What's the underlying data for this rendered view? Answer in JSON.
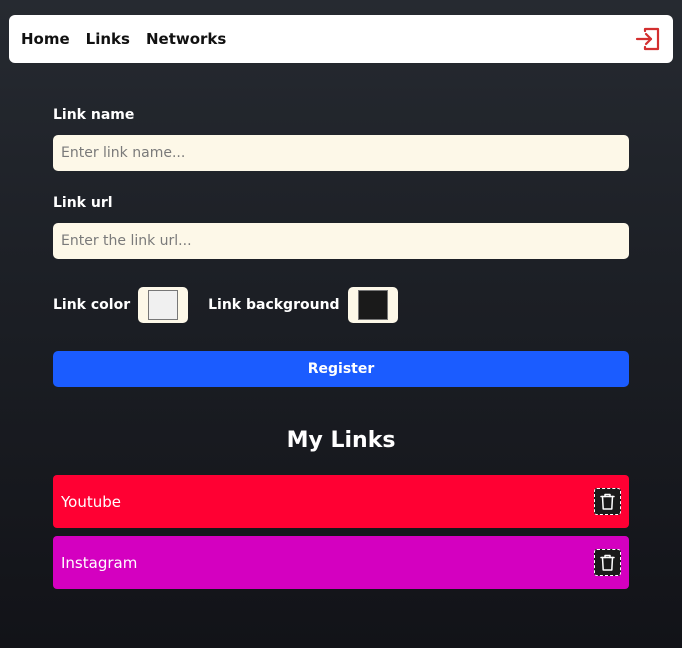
{
  "nav": {
    "items": [
      {
        "label": "Home"
      },
      {
        "label": "Links"
      },
      {
        "label": "Networks"
      }
    ],
    "logout_icon": "logout-icon",
    "logout_color": "#d32f2f"
  },
  "form": {
    "name_label": "Link name",
    "name_placeholder": "Enter link name...",
    "name_value": "",
    "url_label": "Link url",
    "url_placeholder": "Enter the link url...",
    "url_value": "",
    "color_label": "Link color",
    "color_value": "#f0f0f0",
    "background_label": "Link background",
    "background_value": "#1a1a1a",
    "register_label": "Register"
  },
  "links": {
    "title": "My Links",
    "items": [
      {
        "name": "Youtube",
        "color": "#ffffff",
        "background": "#ff0033"
      },
      {
        "name": "Instagram",
        "color": "#ffffff",
        "background": "#d400c0"
      }
    ],
    "delete_icon": "trash-icon"
  },
  "colors": {
    "accent": "#1b5cff",
    "input_bg": "#fdf8e8"
  }
}
